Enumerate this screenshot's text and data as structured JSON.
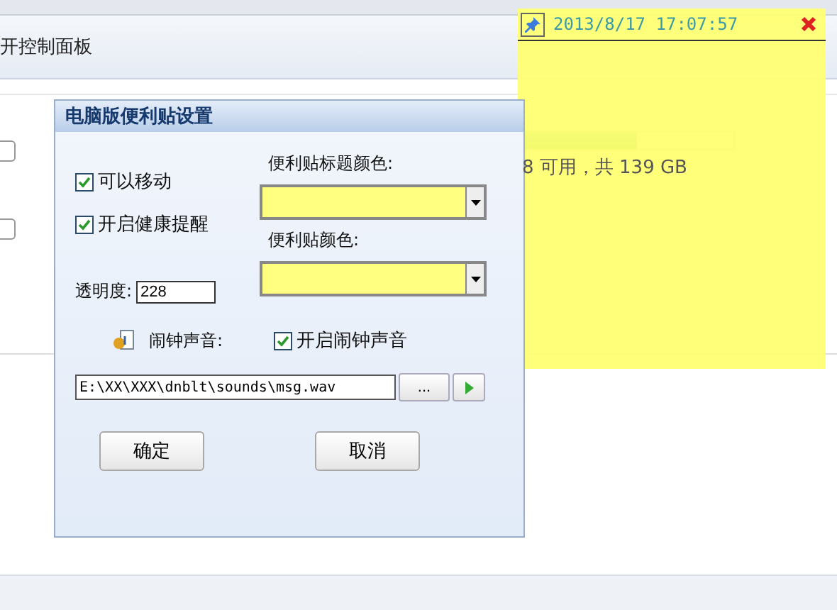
{
  "address_bar": {
    "text": "开控制面板"
  },
  "background": {
    "rows": [
      {
        "checked": false
      },
      {
        "checked": false
      }
    ],
    "drive": {
      "level": 0.54,
      "free_text": "8 可用，共 139 GB"
    }
  },
  "dialog": {
    "title": "电脑版便利贴设置",
    "options": [
      {
        "label": "可以移动",
        "checked": true
      },
      {
        "label": "开启健康提醒",
        "checked": true
      }
    ],
    "title_color_label": "便利贴标题颜色:",
    "note_color_label": "便利贴颜色:",
    "opacity": {
      "label": "透明度:",
      "value": "228"
    },
    "alarm": {
      "label": "闹钟声音:",
      "checkbox": {
        "label": "开启闹钟声音",
        "checked": true
      }
    },
    "sound_path": {
      "value": "E:\\XX\\XXX\\dnblt\\sounds\\msg.wav",
      "browse_label": "..."
    },
    "buttons": [
      "确定",
      "取消"
    ]
  },
  "sticky_note": {
    "timestamp": "2013/8/17 17:07:57",
    "pinned": true
  }
}
